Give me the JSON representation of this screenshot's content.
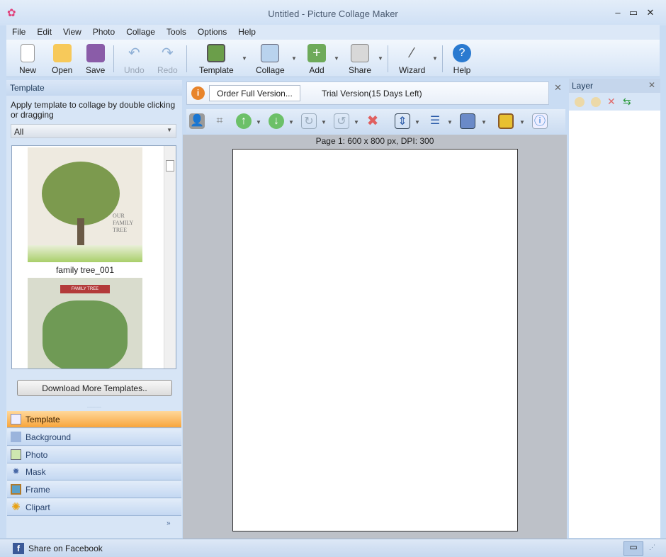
{
  "window": {
    "title": "Untitled - Picture Collage Maker"
  },
  "menu": [
    "File",
    "Edit",
    "View",
    "Photo",
    "Collage",
    "Tools",
    "Options",
    "Help"
  ],
  "toolbar": {
    "new": "New",
    "open": "Open",
    "save": "Save",
    "undo": "Undo",
    "redo": "Redo",
    "template": "Template",
    "collage": "Collage",
    "add": "Add",
    "share": "Share",
    "wizard": "Wizard",
    "help": "Help"
  },
  "left": {
    "header": "Template",
    "description": "Apply template to collage by double clicking or dragging",
    "filter": "All",
    "templates": [
      {
        "name": "family tree_001",
        "caption": "OUR FAMILY TREE"
      },
      {
        "name": "",
        "caption": "FAMILY TREE"
      }
    ],
    "download": "Download More Templates..",
    "categories": [
      "Template",
      "Background",
      "Photo",
      "Mask",
      "Frame",
      "Clipart"
    ]
  },
  "info": {
    "order": "Order Full Version...",
    "trial": "Trial Version(15 Days Left)"
  },
  "canvas": {
    "page_label": "Page 1: 600 x 800 px, DPI: 300"
  },
  "layer": {
    "header": "Layer"
  },
  "status": {
    "facebook": "Share on Facebook"
  },
  "colors": {
    "accent": "#f8a53c",
    "frame": "#c9dcf3"
  }
}
